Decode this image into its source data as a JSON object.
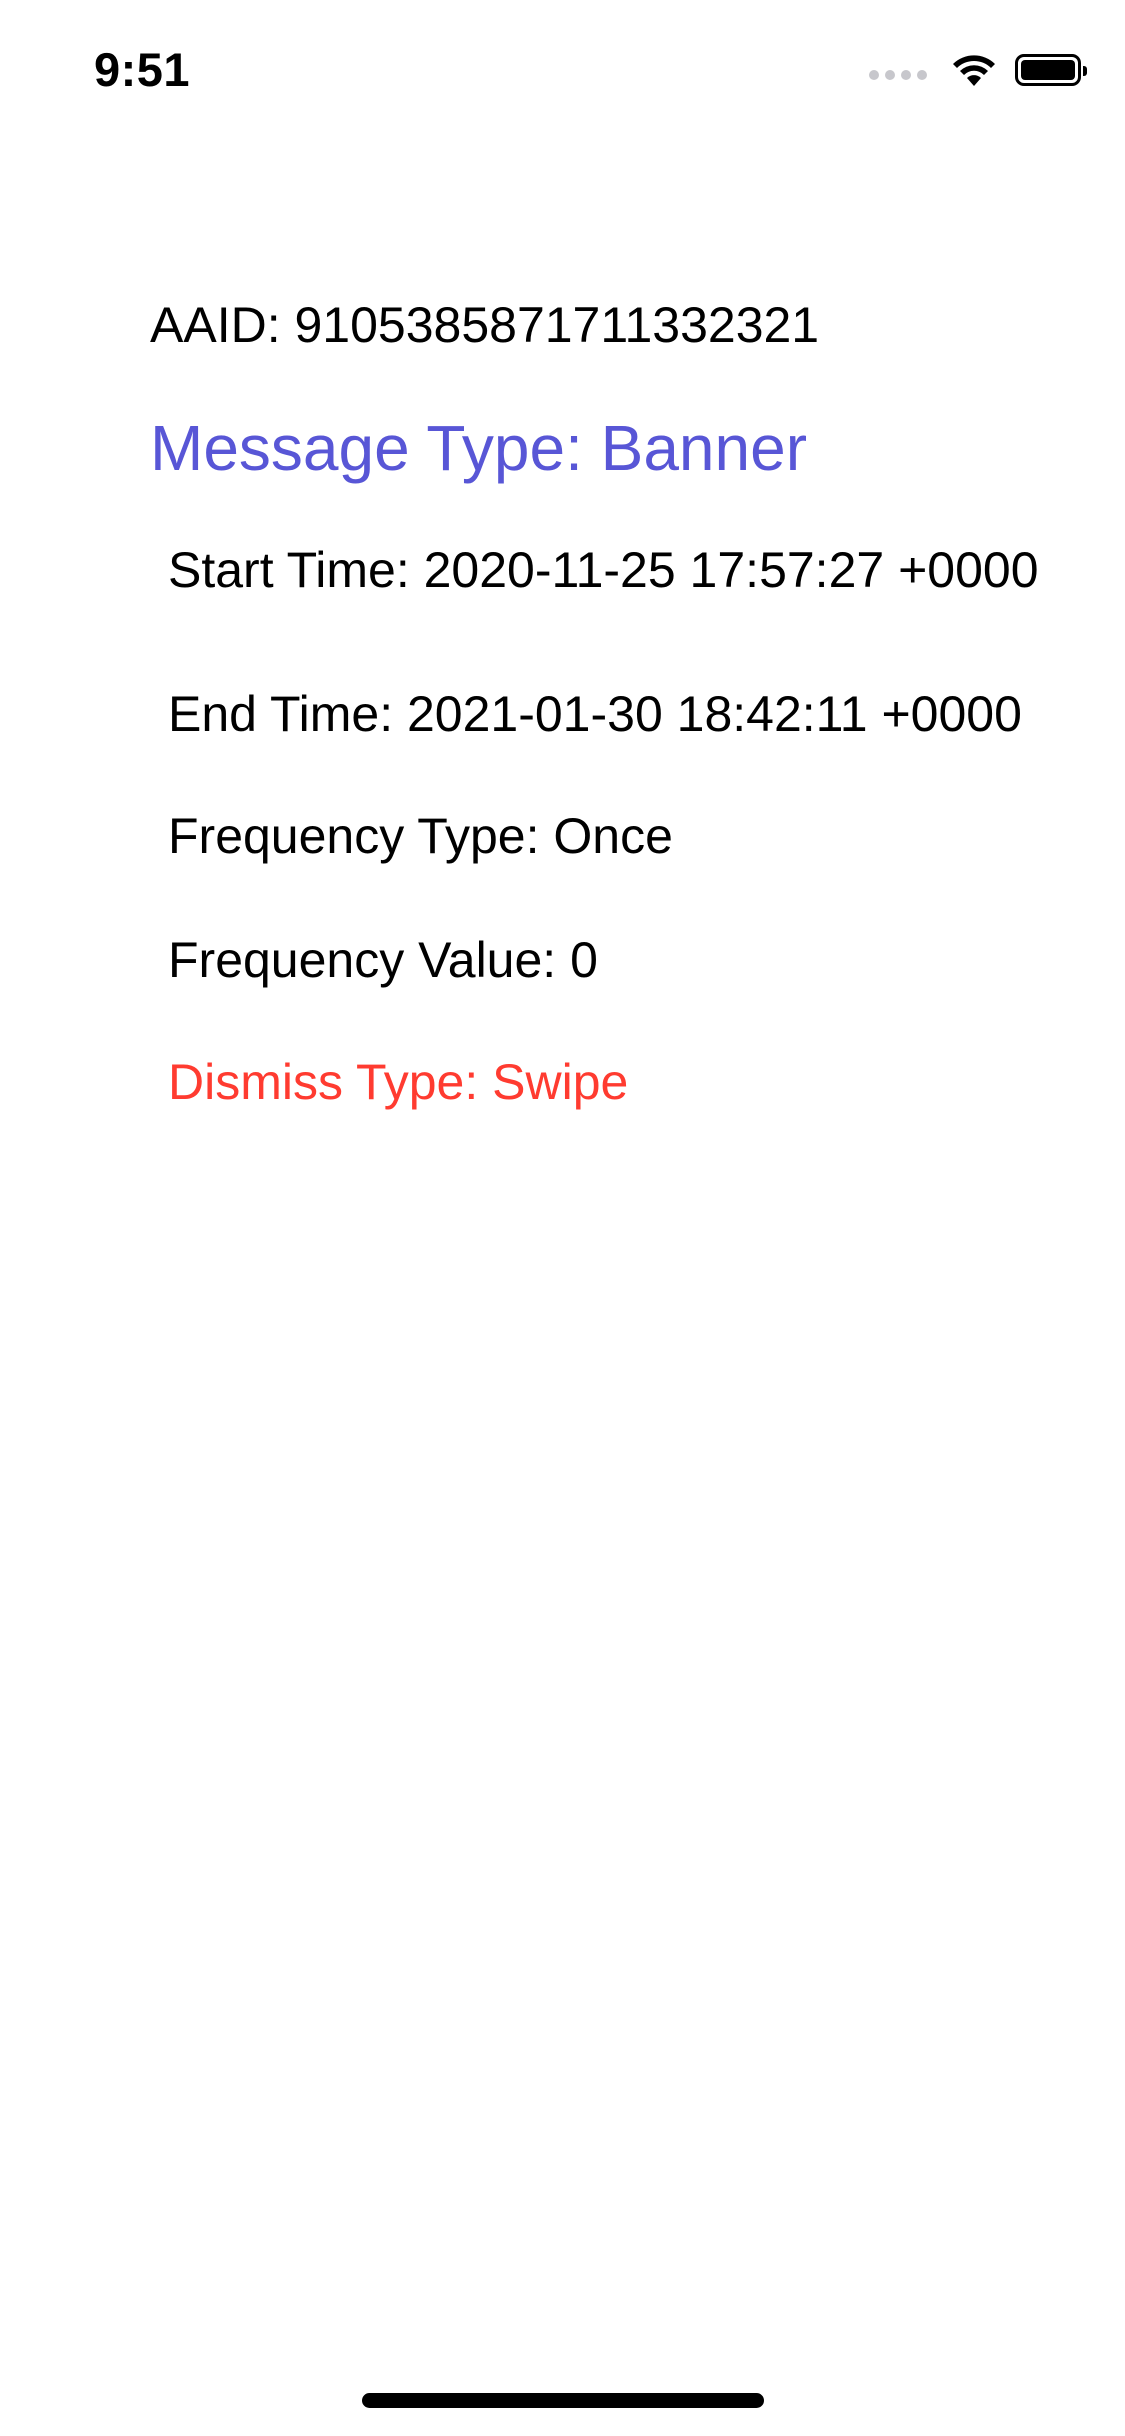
{
  "status_bar": {
    "time": "9:51",
    "icons": [
      "signal-dots-icon",
      "wifi-icon",
      "battery-icon"
    ]
  },
  "details": {
    "aaid": "AAID: 9105385871711332321",
    "message_type": "Message Type: Banner",
    "start_time": "Start Time: 2020-11-25 17:57:27 +0000",
    "end_time": "End Time: 2021-01-30 18:42:11 +0000",
    "frequency_type": "Frequency Type: Once",
    "frequency_value": "Frequency Value: 0",
    "dismiss_type": "Dismiss Type: Swipe"
  },
  "colors": {
    "message_type": "#5856d6",
    "dismiss_type": "#ff3b30",
    "text": "#000000",
    "background": "#ffffff"
  }
}
